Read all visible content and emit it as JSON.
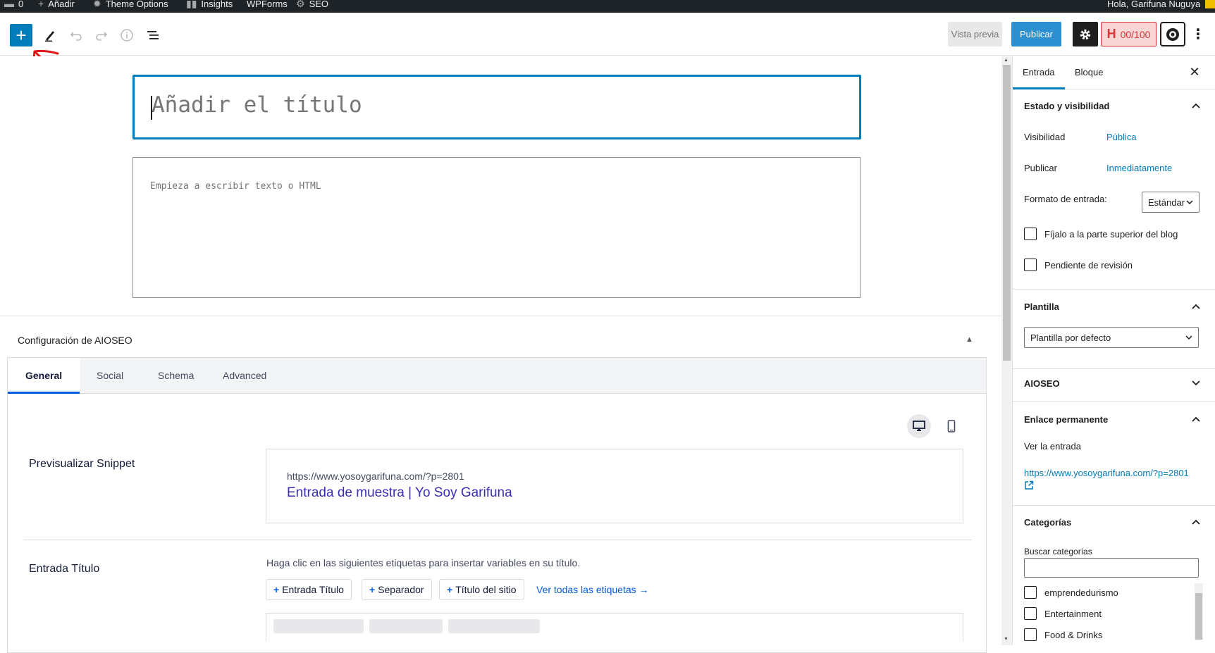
{
  "admin_bar": {
    "comments_count": "0",
    "add_new": "Añadir",
    "theme_options": "Theme Options",
    "insights": "Insights",
    "wpforms": "WPForms",
    "seo": "SEO",
    "greeting": "Hola, Garifuna Nuguya"
  },
  "toolbar": {
    "inserter_icon": "plus-icon",
    "tools_icon": "pencil-icon",
    "undo_icon": "undo-icon",
    "redo_icon": "redo-icon",
    "details_icon": "info-icon",
    "outline_icon": "list-view-icon",
    "preview_label": "Vista previa",
    "publish_label": "Publicar",
    "seo_score": "00/100",
    "colors": {
      "primary": "#007cba",
      "publish": "#2b8fd0",
      "score_bg": "#f9d6d6",
      "score_text": "#d63638"
    }
  },
  "editor": {
    "title_placeholder": "Añadir el título",
    "body_placeholder": "Empieza a escribir texto o HTML"
  },
  "aioseo": {
    "heading": "Configuración de AIOSEO",
    "tabs": [
      {
        "label": "General"
      },
      {
        "label": "Social"
      },
      {
        "label": "Schema"
      },
      {
        "label": "Advanced"
      }
    ],
    "active_tab": "General",
    "snippet": {
      "label": "Previsualizar Snippet",
      "url": "https://www.yosoygarifuna.com/?p=2801",
      "title": "Entrada de muestra | Yo Soy Garifuna"
    },
    "post_title": {
      "label": "Entrada Título",
      "help": "Haga clic en las siguientes etiquetas para insertar variables en su título.",
      "tags": [
        "Entrada Título",
        "Separador",
        "Título del sitio"
      ],
      "view_all": "Ver todas las etiquetas →"
    }
  },
  "sidebar": {
    "tabs": [
      {
        "label": "Entrada"
      },
      {
        "label": "Bloque"
      }
    ],
    "status": {
      "title": "Estado y visibilidad",
      "visibility_label": "Visibilidad",
      "visibility_value": "Pública",
      "publish_label": "Publicar",
      "publish_value": "Inmediatamente",
      "format_label": "Formato de entrada:",
      "format_value": "Estándar",
      "sticky_label": "Fíjalo a la parte superior del blog",
      "pending_label": "Pendiente de revisión"
    },
    "template": {
      "title": "Plantilla",
      "value": "Plantilla por defecto"
    },
    "aioseo": {
      "title": "AIOSEO"
    },
    "permalink": {
      "title": "Enlace permanente",
      "view_label": "Ver la entrada",
      "url": "https://www.yosoygarifuna.com/?p=2801"
    },
    "categories": {
      "title": "Categorías",
      "search_label": "Buscar categorías",
      "items": [
        {
          "label": "emprendedurismo"
        },
        {
          "label": "Entertainment"
        },
        {
          "label": "Food & Drinks"
        }
      ]
    }
  }
}
